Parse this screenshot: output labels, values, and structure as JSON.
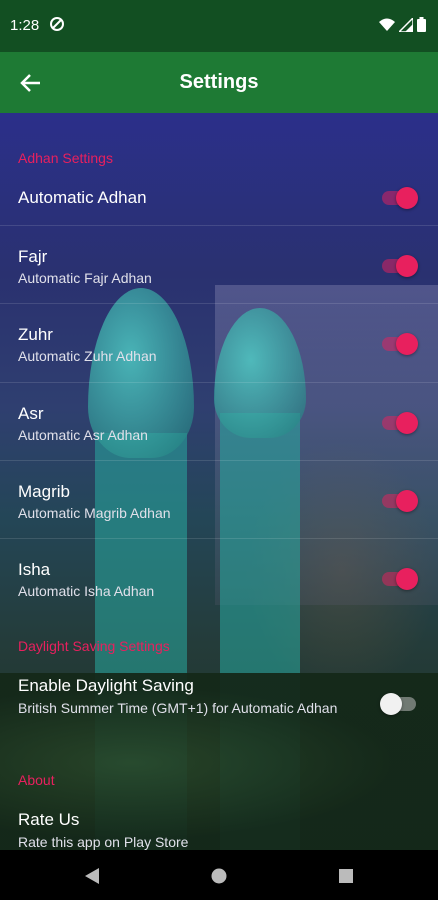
{
  "status_bar": {
    "time": "1:28"
  },
  "app_bar": {
    "title": "Settings"
  },
  "sections": {
    "adhan": {
      "header": "Adhan Settings"
    },
    "daylight": {
      "header": "Daylight Saving Settings"
    },
    "about": {
      "header": "About"
    }
  },
  "prefs": [
    {
      "title": "Automatic Adhan",
      "summary": "",
      "enabled": true
    },
    {
      "title": "Fajr",
      "summary": "Automatic Fajr Adhan",
      "enabled": true
    },
    {
      "title": "Zuhr",
      "summary": "Automatic Zuhr Adhan",
      "enabled": true
    },
    {
      "title": "Asr",
      "summary": "Automatic Asr Adhan",
      "enabled": true
    },
    {
      "title": "Magrib",
      "summary": "Automatic Magrib Adhan",
      "enabled": true
    },
    {
      "title": "Isha",
      "summary": "Automatic Isha Adhan",
      "enabled": true
    }
  ],
  "daylight": {
    "title": "Enable Daylight Saving",
    "summary": "British Summer Time (GMT+1) for Automatic Adhan",
    "enabled": false
  },
  "about": {
    "title": "Rate Us",
    "summary": "Rate this app on Play Store"
  },
  "colors": {
    "accent": "#e8205e",
    "status_bar": "#124f22",
    "app_bar": "#1e7a34"
  }
}
